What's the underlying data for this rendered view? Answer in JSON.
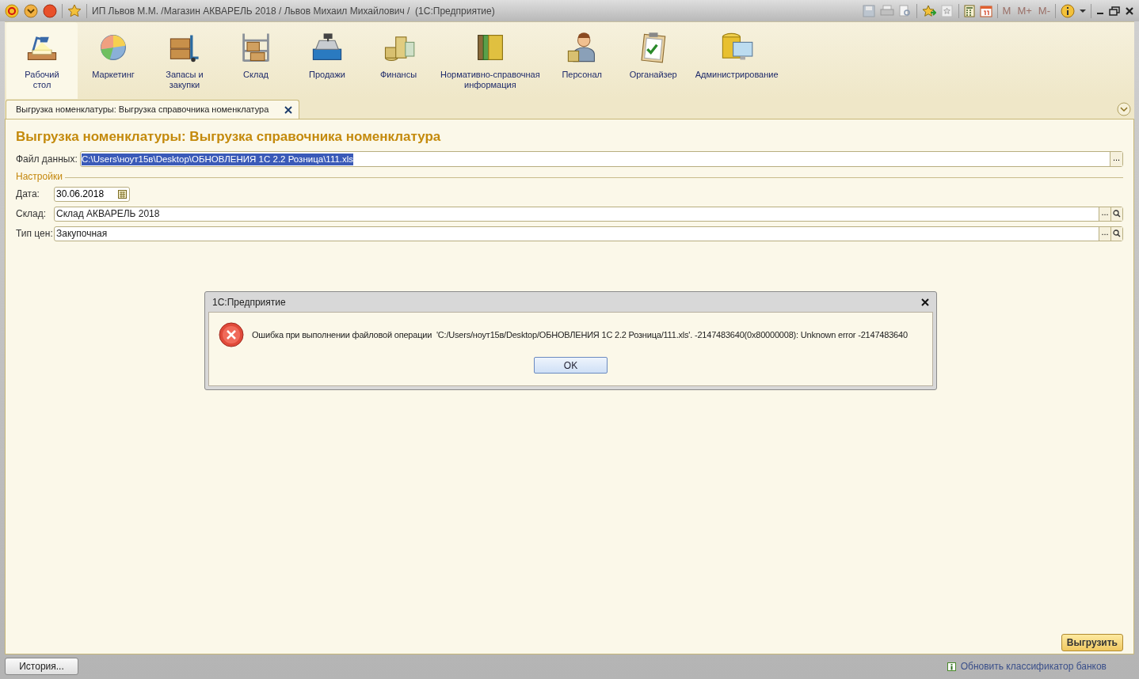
{
  "window": {
    "title": "ИП Львов М.М. /Магазин АКВАРЕЛЬ 2018 / Львов Михаил Михайлович /  (1С:Предприятие)"
  },
  "toolbar": {
    "memory_buttons": [
      {
        "label": "M",
        "disabled": true
      },
      {
        "label": "M+",
        "disabled": true
      },
      {
        "label": "M-",
        "disabled": true
      }
    ]
  },
  "sections": [
    {
      "label": "Рабочий\nстол",
      "selected": true
    },
    {
      "label": "Маркетинг",
      "selected": false
    },
    {
      "label": "Запасы и\nзакупки",
      "selected": false
    },
    {
      "label": "Склад",
      "selected": false
    },
    {
      "label": "Продажи",
      "selected": false
    },
    {
      "label": "Финансы",
      "selected": false
    },
    {
      "label": "Нормативно-справочная\nинформация",
      "selected": false
    },
    {
      "label": "Персонал",
      "selected": false
    },
    {
      "label": "Органайзер",
      "selected": false
    },
    {
      "label": "Администрирование",
      "selected": false
    }
  ],
  "tabs": [
    {
      "label": "Выгрузка номенклатуры: Выгрузка справочника номенклатура",
      "selected": true
    }
  ],
  "form": {
    "title": "Выгрузка номенклатуры: Выгрузка справочника номенклатура",
    "data_file": {
      "label": "Файл данных:",
      "value": "C:\\Users\\ноут15в\\Desktop\\ОБНОВЛЕНИЯ 1С 2.2 Розница\\111.xls",
      "text_selected": true,
      "select_button": "..."
    },
    "settings_group": "Настройки",
    "date": {
      "label": "Дата:",
      "value": "30.06.2018"
    },
    "fields": [
      {
        "label": "Склад:",
        "value": "Склад АКВАРЕЛЬ 2018",
        "select_button": "..."
      },
      {
        "label": "Тип цен:",
        "value": "Закупочная",
        "select_button": "..."
      }
    ],
    "export_button": "Выгрузить"
  },
  "dialog": {
    "title": "1С:Предприятие",
    "message": "Ошибка при выполнении файловой операции  'C:/Users/ноут15в/Desktop/ОБНОВЛЕНИЯ 1С 2.2 Розница/111.xls'. -2147483640(0x80000008): Unknown error -2147483640",
    "button": "OK"
  },
  "status_bar": {
    "history_button": "История...",
    "link": "Обновить классификатор банков"
  }
}
